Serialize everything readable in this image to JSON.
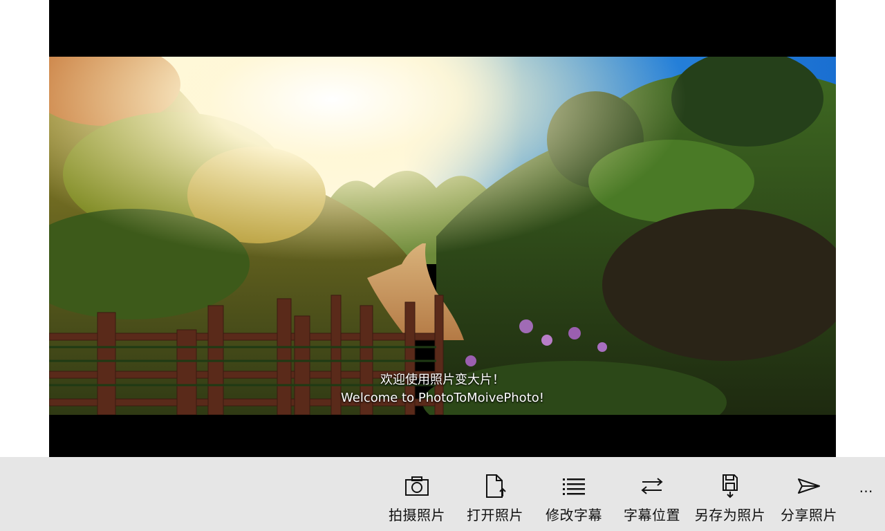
{
  "preview": {
    "subtitle_cn": "欢迎使用照片变大片！",
    "subtitle_en": "Welcome to PhotoToMoivePhoto!",
    "photo_description_icon": "photo-image"
  },
  "appbar": {
    "commands": [
      {
        "label": "拍摄照片",
        "icon": "camera-icon"
      },
      {
        "label": "打开照片",
        "icon": "open-file-icon"
      },
      {
        "label": "修改字幕",
        "icon": "list-icon"
      },
      {
        "label": "字幕位置",
        "icon": "swap-arrows-icon"
      },
      {
        "label": "另存为照片",
        "icon": "save-icon"
      },
      {
        "label": "分享照片",
        "icon": "send-icon"
      }
    ],
    "more_label": "…",
    "background_color": "#e6e6e6"
  }
}
